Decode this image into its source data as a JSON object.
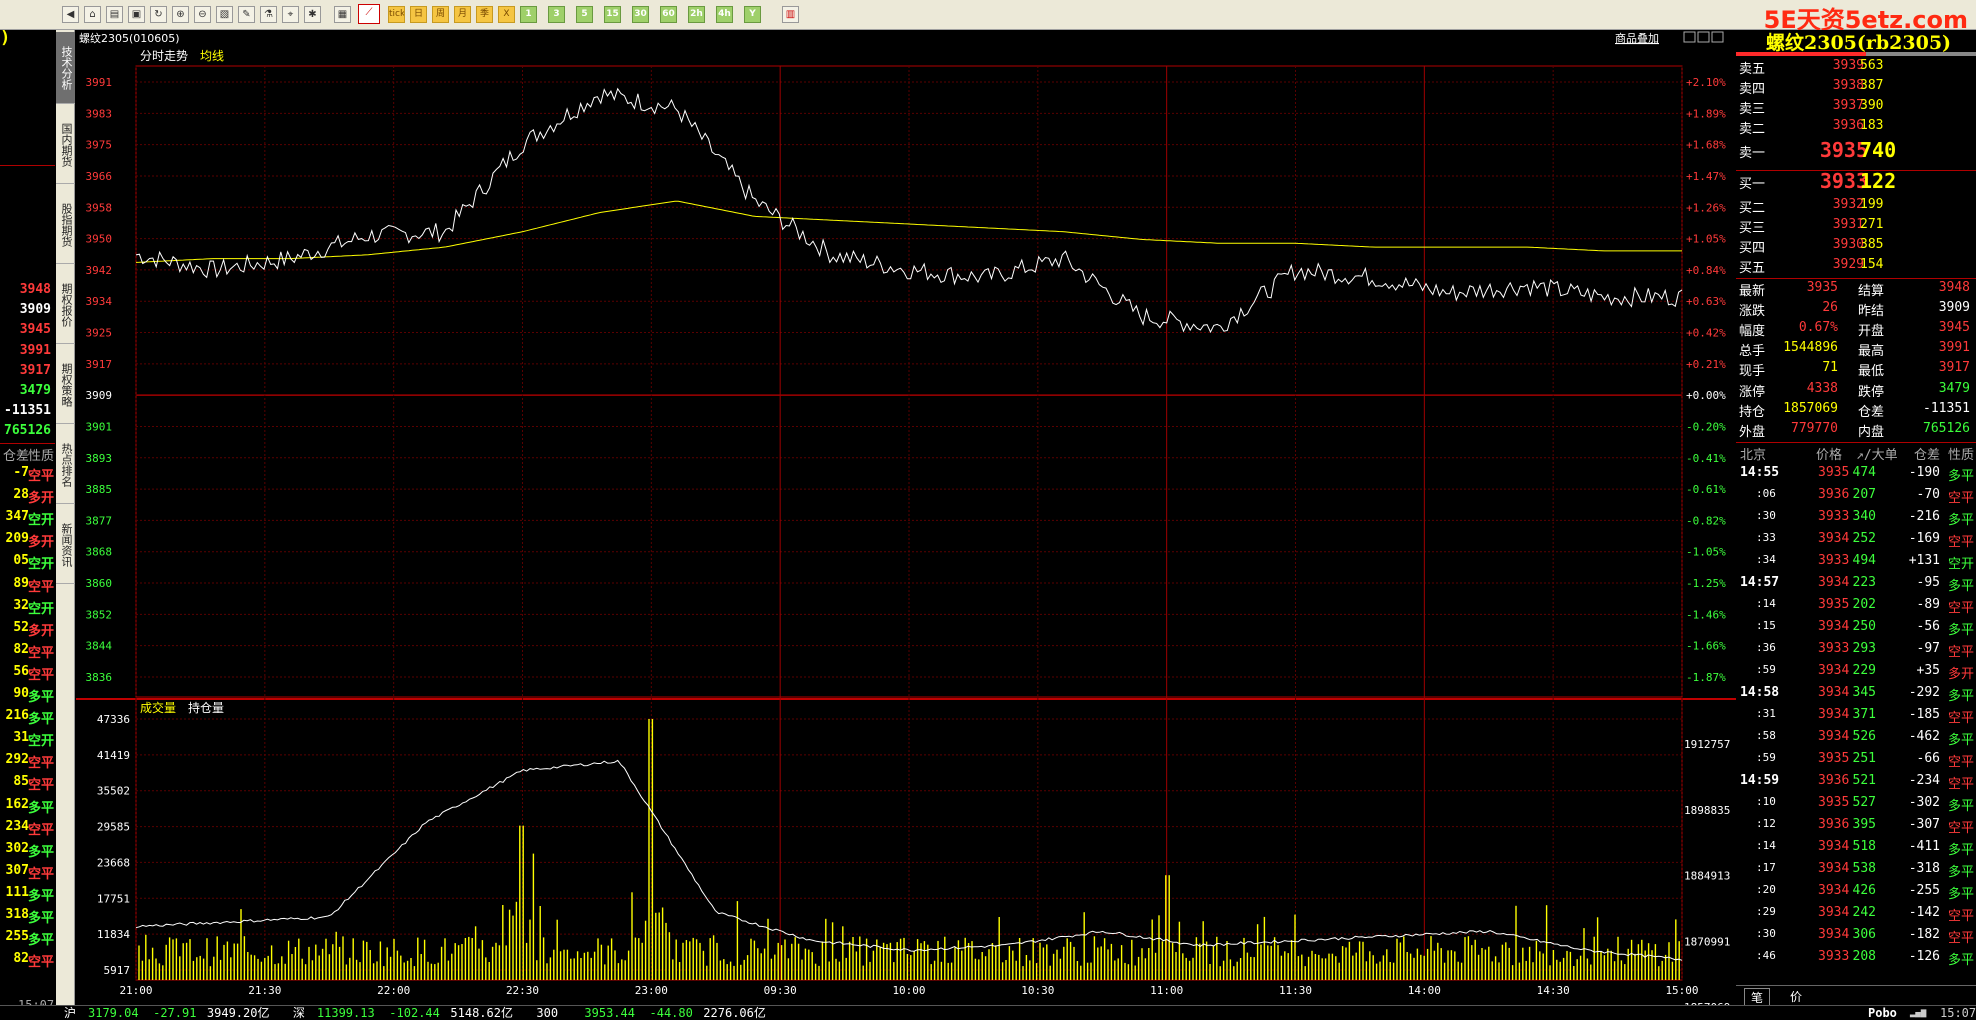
{
  "watermark": "5E天资5etz.com",
  "toolbar": {
    "num_buttons": [
      "1",
      "3",
      "5",
      "15",
      "30",
      "60",
      "2h",
      "4h",
      "Y"
    ],
    "period_buttons": [
      "tick",
      "日",
      "周",
      "月",
      "季",
      "X"
    ]
  },
  "side_tabs": [
    "技术分析",
    "国内期货",
    "股指期货",
    "期权报价",
    "期权策略",
    "热点排名",
    "新闻资讯"
  ],
  "chart": {
    "instrument": "螺纹2305(010605)",
    "right_button": "商品叠加",
    "price_labels": {
      "tab_trend": "分时走势",
      "tab_avg": "均线"
    },
    "volume_labels": {
      "tab_vol": "成交量",
      "tab_oi": "持仓量"
    },
    "price_ticks": [
      "3991",
      "3983",
      "3975",
      "3966",
      "3958",
      "3950",
      "3942",
      "3934",
      "3925",
      "3917",
      "3909",
      "3901",
      "3893",
      "3885",
      "3877",
      "3868",
      "3860",
      "3852",
      "3844",
      "3836"
    ],
    "pct_ticks": [
      "+2.10%",
      "+1.89%",
      "+1.68%",
      "+1.47%",
      "+1.26%",
      "+1.05%",
      "+0.84%",
      "+0.63%",
      "+0.42%",
      "+0.21%",
      "+0.00%",
      "-0.20%",
      "-0.41%",
      "-0.61%",
      "-0.82%",
      "-1.05%",
      "-1.25%",
      "-1.46%",
      "-1.66%",
      "-1.87%"
    ],
    "vol_ticks": [
      "47336",
      "41419",
      "35502",
      "29585",
      "23668",
      "17751",
      "11834",
      "5917"
    ],
    "oi_ticks": [
      "1912757",
      "1898835",
      "1884913",
      "1870991",
      "1857069"
    ],
    "time_ticks": [
      "21:00",
      "21:30",
      "22:00",
      "22:30",
      "23:00",
      "09:30",
      "10:00",
      "10:30",
      "11:00",
      "11:30",
      "14:00",
      "14:30",
      "15:00"
    ]
  },
  "chart_data": {
    "type": "line",
    "title": "螺纹2305(010605)",
    "x": [
      "21:00",
      "21:30",
      "22:00",
      "22:30",
      "23:00",
      "09:30",
      "10:00",
      "10:30",
      "11:00",
      "11:30",
      "14:00",
      "14:30",
      "15:00"
    ],
    "ylim": [
      3836,
      3991
    ],
    "reference_price": 3909,
    "series": [
      {
        "name": "分时走势",
        "values": [
          3946,
          3942,
          3945,
          3951,
          3952,
          3975,
          3988,
          3984,
          3960,
          3946,
          3942,
          3940,
          3945,
          3930,
          3927,
          3942,
          3940,
          3936,
          3938,
          3935,
          3935
        ]
      },
      {
        "name": "均线",
        "values": [
          3944,
          3945,
          3945,
          3946,
          3948,
          3952,
          3957,
          3960,
          3956,
          3955,
          3954,
          3953,
          3952,
          3950,
          3949,
          3949,
          3948,
          3948,
          3948,
          3947,
          3947
        ]
      }
    ],
    "volume": {
      "ylim": [
        0,
        47336
      ],
      "peaks": [
        {
          "time": "22:30",
          "value": 28000
        },
        {
          "time": "23:00",
          "value": 47336
        },
        {
          "time": "11:00",
          "value": 19000
        }
      ]
    },
    "open_interest": {
      "ylim": [
        1857069,
        1912757
      ],
      "values": [
        1875000,
        1876000,
        1877000,
        1897000,
        1908000,
        1910000,
        1878000,
        1872000,
        1870000,
        1871000,
        1874000,
        1871000,
        1872000,
        1873000,
        1874000,
        1870000,
        1868000
      ]
    }
  },
  "quote": {
    "title": "螺纹2305(rb2305)",
    "asks": [
      {
        "label": "卖五",
        "price": "3939",
        "vol": "563"
      },
      {
        "label": "卖四",
        "price": "3938",
        "vol": "387"
      },
      {
        "label": "卖三",
        "price": "3937",
        "vol": "390"
      },
      {
        "label": "卖二",
        "price": "3936",
        "vol": "183"
      },
      {
        "label": "卖一",
        "price": "3935",
        "vol": "740"
      }
    ],
    "bids": [
      {
        "label": "买一",
        "price": "3933",
        "vol": "122"
      },
      {
        "label": "买二",
        "price": "3932",
        "vol": "199"
      },
      {
        "label": "买三",
        "price": "3931",
        "vol": "271"
      },
      {
        "label": "买四",
        "price": "3930",
        "vol": "385"
      },
      {
        "label": "买五",
        "price": "3929",
        "vol": "154"
      }
    ],
    "stats": [
      {
        "l1": "最新",
        "v1": "3935",
        "c1": "red",
        "l2": "结算",
        "v2": "3948",
        "c2": "red"
      },
      {
        "l1": "涨跌",
        "v1": "26",
        "c1": "red",
        "l2": "昨结",
        "v2": "3909",
        "c2": "white"
      },
      {
        "l1": "幅度",
        "v1": "0.67%",
        "c1": "red",
        "l2": "开盘",
        "v2": "3945",
        "c2": "red"
      },
      {
        "l1": "总手",
        "v1": "1544896",
        "c1": "yellow",
        "l2": "最高",
        "v2": "3991",
        "c2": "red"
      },
      {
        "l1": "现手",
        "v1": "71",
        "c1": "yellow",
        "l2": "最低",
        "v2": "3917",
        "c2": "red"
      },
      {
        "l1": "涨停",
        "v1": "4338",
        "c1": "red",
        "l2": "跌停",
        "v2": "3479",
        "c2": "green"
      },
      {
        "l1": "持仓",
        "v1": "1857069",
        "c1": "yellow",
        "l2": "仓差",
        "v2": "-11351",
        "c2": "white"
      },
      {
        "l1": "外盘",
        "v1": "779770",
        "c1": "red",
        "l2": "内盘",
        "v2": "765126",
        "c2": "green"
      }
    ],
    "ticks_header": [
      "北京",
      "价格",
      "↗/大单",
      "仓差",
      "性质"
    ],
    "ticks": [
      {
        "t": "14:55",
        "p": "3935",
        "v": "474",
        "d": "-190",
        "n": "多平",
        "pc": "red",
        "nc": "green"
      },
      {
        "t": ":06",
        "p": "3936",
        "v": "207",
        "d": "-70",
        "n": "空平",
        "pc": "red",
        "nc": "red"
      },
      {
        "t": ":30",
        "p": "3933",
        "v": "340",
        "d": "-216",
        "n": "多平",
        "pc": "red",
        "nc": "green"
      },
      {
        "t": ":33",
        "p": "3934",
        "v": "252",
        "d": "-169",
        "n": "空平",
        "pc": "red",
        "nc": "red"
      },
      {
        "t": ":34",
        "p": "3933",
        "v": "494",
        "d": "+131",
        "n": "空开",
        "pc": "red",
        "nc": "green"
      },
      {
        "t": "14:57",
        "p": "3934",
        "v": "223",
        "d": "-95",
        "n": "多平",
        "pc": "red",
        "nc": "green"
      },
      {
        "t": ":14",
        "p": "3935",
        "v": "202",
        "d": "-89",
        "n": "空平",
        "pc": "red",
        "nc": "red"
      },
      {
        "t": ":15",
        "p": "3934",
        "v": "250",
        "d": "-56",
        "n": "多平",
        "pc": "red",
        "nc": "green"
      },
      {
        "t": ":36",
        "p": "3933",
        "v": "293",
        "d": "-97",
        "n": "空平",
        "pc": "red",
        "nc": "red"
      },
      {
        "t": ":59",
        "p": "3934",
        "v": "229",
        "d": "+35",
        "n": "多开",
        "pc": "red",
        "nc": "red"
      },
      {
        "t": "14:58",
        "p": "3934",
        "v": "345",
        "d": "-292",
        "n": "多平",
        "pc": "red",
        "nc": "green"
      },
      {
        "t": ":31",
        "p": "3934",
        "v": "371",
        "d": "-185",
        "n": "空平",
        "pc": "red",
        "nc": "red"
      },
      {
        "t": ":58",
        "p": "3934",
        "v": "526",
        "d": "-462",
        "n": "多平",
        "pc": "red",
        "nc": "green"
      },
      {
        "t": ":59",
        "p": "3935",
        "v": "251",
        "d": "-66",
        "n": "空平",
        "pc": "red",
        "nc": "red"
      },
      {
        "t": "14:59",
        "p": "3936",
        "v": "521",
        "d": "-234",
        "n": "空平",
        "pc": "red",
        "nc": "red"
      },
      {
        "t": ":10",
        "p": "3935",
        "v": "527",
        "d": "-302",
        "n": "多平",
        "pc": "red",
        "nc": "green"
      },
      {
        "t": ":12",
        "p": "3936",
        "v": "395",
        "d": "-307",
        "n": "空平",
        "pc": "red",
        "nc": "red"
      },
      {
        "t": ":14",
        "p": "3934",
        "v": "518",
        "d": "-411",
        "n": "多平",
        "pc": "red",
        "nc": "green"
      },
      {
        "t": ":17",
        "p": "3934",
        "v": "538",
        "d": "-318",
        "n": "多平",
        "pc": "red",
        "nc": "green"
      },
      {
        "t": ":20",
        "p": "3934",
        "v": "426",
        "d": "-255",
        "n": "多平",
        "pc": "red",
        "nc": "green"
      },
      {
        "t": ":29",
        "p": "3934",
        "v": "242",
        "d": "-142",
        "n": "空平",
        "pc": "red",
        "nc": "red"
      },
      {
        "t": ":30",
        "p": "3934",
        "v": "306",
        "d": "-182",
        "n": "空平",
        "pc": "red",
        "nc": "red"
      },
      {
        "t": ":46",
        "p": "3933",
        "v": "208",
        "d": "-126",
        "n": "多平",
        "pc": "red",
        "nc": "green"
      }
    ],
    "bottom_tabs": [
      "笔",
      "价"
    ]
  },
  "left_panel": {
    "top_char": ")",
    "values": [
      {
        "v": "3948",
        "c": "red"
      },
      {
        "v": "3909",
        "c": "white"
      },
      {
        "v": "3945",
        "c": "red"
      },
      {
        "v": "3991",
        "c": "red"
      },
      {
        "v": "3917",
        "c": "red"
      },
      {
        "v": "3479",
        "c": "green"
      },
      {
        "v": "-11351",
        "c": "white"
      },
      {
        "v": "765126",
        "c": "green"
      }
    ],
    "header_a": "仓差",
    "header_b": "性质",
    "rows": [
      {
        "a": "-7",
        "b": "空平",
        "bc": "red"
      },
      {
        "a": "28",
        "b": "多开",
        "bc": "red"
      },
      {
        "a": "347",
        "b": "空开",
        "bc": "green"
      },
      {
        "a": "209",
        "b": "多开",
        "bc": "red"
      },
      {
        "a": "05",
        "b": "空开",
        "bc": "green"
      },
      {
        "a": "89",
        "b": "空平",
        "bc": "red"
      },
      {
        "a": "32",
        "b": "空开",
        "bc": "green"
      },
      {
        "a": "52",
        "b": "多开",
        "bc": "red"
      },
      {
        "a": "82",
        "b": "空平",
        "bc": "red"
      },
      {
        "a": "56",
        "b": "空平",
        "bc": "red"
      },
      {
        "a": "90",
        "b": "多平",
        "bc": "green"
      },
      {
        "a": "216",
        "b": "多平",
        "bc": "green"
      },
      {
        "a": "31",
        "b": "空开",
        "bc": "green"
      },
      {
        "a": "292",
        "b": "空平",
        "bc": "red"
      },
      {
        "a": "85",
        "b": "空平",
        "bc": "red"
      },
      {
        "a": "162",
        "b": "多平",
        "bc": "green"
      },
      {
        "a": "234",
        "b": "空平",
        "bc": "red"
      },
      {
        "a": "302",
        "b": "多平",
        "bc": "green"
      },
      {
        "a": "307",
        "b": "空平",
        "bc": "red"
      },
      {
        "a": "111",
        "b": "多平",
        "bc": "green"
      },
      {
        "a": "318",
        "b": "多平",
        "bc": "green"
      },
      {
        "a": "255",
        "b": "多平",
        "bc": "green"
      },
      {
        "a": "82",
        "b": "空平",
        "bc": "red"
      }
    ]
  },
  "status_bar": {
    "items": [
      {
        "label": "沪",
        "v1": "3179.04",
        "v2": "-27.91",
        "v3": "3949.20亿"
      },
      {
        "label": "深",
        "v1": "11399.13",
        "v2": "-102.44",
        "v3": "5148.62亿"
      },
      {
        "label": "300",
        "v1": "3953.44",
        "v2": "-44.80",
        "v3": "2276.06亿"
      }
    ],
    "left_time": "15:07",
    "brand": "Pobo",
    "right_time": "15:07"
  },
  "colors": {
    "up": "#ff3a3a",
    "down": "#3cff3c",
    "vol": "#ffff00",
    "grid": "#8b0000",
    "price_line": "#ffffff",
    "avg_line": "#ffff00"
  }
}
